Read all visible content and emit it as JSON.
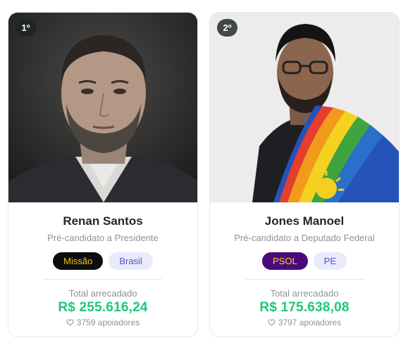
{
  "candidates": [
    {
      "rank": "1º",
      "name": "Renan Santos",
      "role": "Pré-candidato a Presidente",
      "party": "Missão",
      "region": "Brasil",
      "raised_label": "Total arrecadado",
      "amount": "R$ 255.616,24",
      "supporters": "3759 apoiadores",
      "party_colors": {
        "bg": "#0d0d0d",
        "fg": "#f5c518"
      }
    },
    {
      "rank": "2º",
      "name": "Jones Manoel",
      "role": "Pré-candidato a Deputado Federal",
      "party": "PSOL",
      "region": "PE",
      "raised_label": "Total arrecadado",
      "amount": "R$ 175.638,08",
      "supporters": "3797 apoiadores",
      "party_colors": {
        "bg": "#4a0a78",
        "fg": "#ffd32a"
      }
    }
  ],
  "colors": {
    "amount": "#1fc77a",
    "region_bg": "#e9ebfc",
    "region_fg": "#4a55c9"
  },
  "icons": {
    "supporters": "heart-icon"
  }
}
